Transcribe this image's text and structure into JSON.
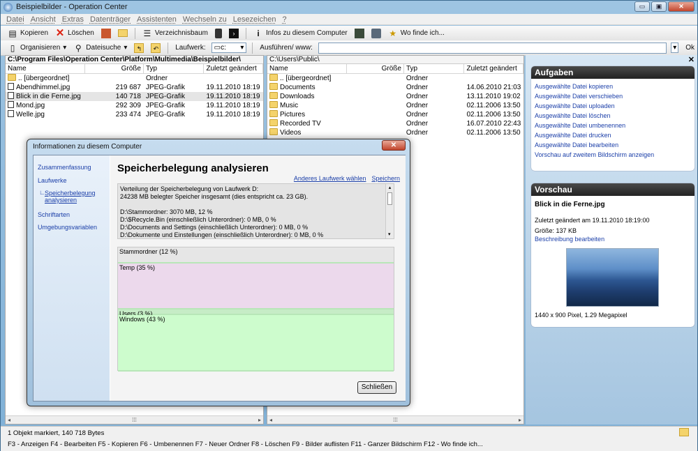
{
  "window": {
    "title": "Beispielbilder - Operation Center",
    "btn_min": "▭",
    "btn_max": "▣",
    "btn_close": "✕"
  },
  "menu": [
    "Datei",
    "Ansicht",
    "Extras",
    "Datenträger",
    "Assistenten",
    "Wechseln zu",
    "Lesezeichen",
    "?"
  ],
  "toolbar1": {
    "copy": "Kopieren",
    "delete": "Löschen",
    "tree": "Verzeichnisbaum",
    "info": "Infos zu diesem Computer",
    "find": "Wo finde ich..."
  },
  "toolbar2": {
    "organize": "Organisieren",
    "search": "Dateisuche",
    "drive_label": "Laufwerk:",
    "drive_value": "c:",
    "run_label": "Ausführen/ www:",
    "ok": "Ok"
  },
  "left_pane": {
    "path": "C:\\Program Files\\Operation Center\\Platform\\Multimedia\\Beispielbilder\\",
    "columns": [
      "Name",
      "Größe",
      "Typ",
      "Zuletzt geändert"
    ],
    "rows": [
      {
        "name": ".. [übergeordnet]",
        "size": "",
        "type": "Ordner",
        "date": ""
      },
      {
        "name": "Abendhimmel.jpg",
        "size": "219 687",
        "type": "JPEG-Grafik",
        "date": "19.11.2010 18:19"
      },
      {
        "name": "Blick in die Ferne.jpg",
        "size": "140 718",
        "type": "JPEG-Grafik",
        "date": "19.11.2010 18:19"
      },
      {
        "name": "Mond.jpg",
        "size": "292 309",
        "type": "JPEG-Grafik",
        "date": "19.11.2010 18:19"
      },
      {
        "name": "Welle.jpg",
        "size": "233 474",
        "type": "JPEG-Grafik",
        "date": "19.11.2010 18:19"
      }
    ]
  },
  "right_file_pane": {
    "path": "C:\\Users\\Public\\",
    "columns": [
      "Name",
      "Größe",
      "Typ",
      "Zuletzt geändert"
    ],
    "rows": [
      {
        "name": ".. [übergeordnet]",
        "type": "Ordner",
        "date": ""
      },
      {
        "name": "Documents",
        "type": "Ordner",
        "date": "14.06.2010 21:03"
      },
      {
        "name": "Downloads",
        "type": "Ordner",
        "date": "13.11.2010 19:02"
      },
      {
        "name": "Music",
        "type": "Ordner",
        "date": "02.11.2006 13:50"
      },
      {
        "name": "Pictures",
        "type": "Ordner",
        "date": "02.11.2006 13:50"
      },
      {
        "name": "Recorded TV",
        "type": "Ordner",
        "date": "16.07.2010 22:43"
      },
      {
        "name": "Videos",
        "type": "Ordner",
        "date": "02.11.2006 13:50"
      }
    ]
  },
  "tasks": {
    "title": "Aufgaben",
    "items": [
      "Ausgewählte Datei kopieren",
      "Ausgewählte Datei verschieben",
      "Ausgewählte Datei uploaden",
      "Ausgewählte Datei löschen",
      "Ausgewählte Datei umbenennen",
      "Ausgewählte Datei drucken",
      "Ausgewählte Datei bearbeiten",
      "Vorschau auf zweitem Bildschirm anzeigen"
    ]
  },
  "preview": {
    "title": "Vorschau",
    "filename": "Blick in die Ferne.jpg",
    "modified": "Zuletzt geändert am 19.11.2010 18:19:00",
    "size": "Größe: 137 KB",
    "edit_link": "Beschreibung bearbeiten",
    "dimensions": "1440 x 900 Pixel, 1.29 Megapixel"
  },
  "status": {
    "selection": "1 Objekt markiert, 140 718 Bytes",
    "keys": "F3 - Anzeigen   F4 - Bearbeiten   F5 - Kopieren   F6 - Umbenennen   F7 - Neuer Ordner   F8 - Löschen   F9 - Bilder auflisten   F11 - Ganzer Bildschirm   F12 - Wo finde ich..."
  },
  "dialog": {
    "title": "Informationen zu diesem Computer",
    "nav": [
      "Zusammenfassung",
      "Laufwerke",
      "Speicherbelegung analysieren",
      "Schriftarten",
      "Umgebungsvariablen"
    ],
    "heading": "Speicherbelegung analysieren",
    "link_drive": "Anderes Laufwerk wählen",
    "link_save": "Speichern",
    "text_lines": [
      "Verteilung der Speicherbelegung von Laufwerk D:",
      "24238 MB belegter Speicher insgesamt (dies entspricht ca. 23 GB).",
      "",
      "D:\\Stammordner: 3070 MB,  12 %",
      "D:\\$Recycle.Bin (einschließlich Unterordner): 0 MB,  0 %",
      "D:\\Documents and Settings (einschließlich Unterordner): 0 MB,  0 %",
      "D:\\Dokumente und Einstellungen (einschließlich Unterordner): 0 MB,  0 %"
    ],
    "segments": [
      {
        "label": "Stammordner (12 %)",
        "percent": 12,
        "color": "#e6e6e6"
      },
      {
        "label": "Temp (35 %)",
        "percent": 35,
        "color": "#ecd9ec"
      },
      {
        "label": "Users (3 %)",
        "percent": 3,
        "color": "#c6ecc6"
      },
      {
        "label": "Windows (43 %)",
        "percent": 43,
        "color": "#cdfccd"
      }
    ],
    "close": "Schließen"
  }
}
